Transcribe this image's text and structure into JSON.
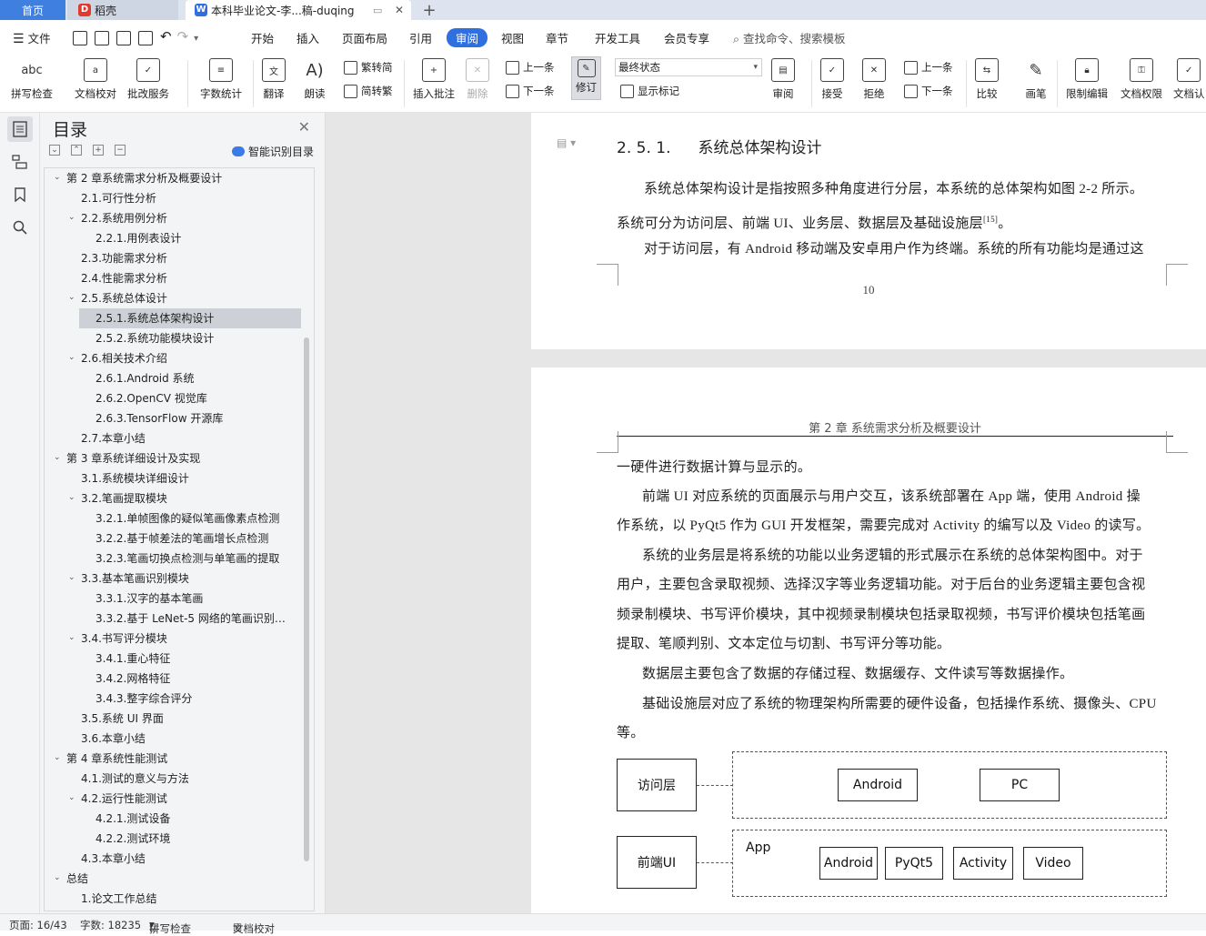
{
  "tabs": {
    "home": "首页",
    "docer": "稻壳",
    "doc": "本科毕业论文-李...稿-duqing",
    "add": "+"
  },
  "menu": {
    "file": "文件",
    "items": [
      "开始",
      "插入",
      "页面布局",
      "引用",
      "审阅",
      "视图",
      "章节",
      "开发工具",
      "会员专享"
    ],
    "search": "查找命令、搜索模板"
  },
  "ribbon": {
    "spell": "拼写检查",
    "proof": "文档校对",
    "correct": "批改服务",
    "wordcount": "字数统计",
    "translate": "翻译",
    "read": "朗读",
    "trad": "繁转简",
    "simp": "简转繁",
    "insert_comment": "插入批注",
    "delete": "删除",
    "prev": "上一条",
    "next": "下一条",
    "revise": "修订",
    "status": "最终状态",
    "show_marks": "显示标记",
    "review": "审阅",
    "accept": "接受",
    "reject": "拒绝",
    "prev2": "上一条",
    "next2": "下一条",
    "compare": "比较",
    "pen": "画笔",
    "restrict": "限制编辑",
    "perm": "文档权限",
    "cert": "文档认"
  },
  "toc": {
    "title": "目录",
    "smart": "智能识别目录",
    "items": [
      {
        "t": "第 2 章系统需求分析及概要设计",
        "l": 0,
        "e": "v"
      },
      {
        "t": "2.1.可行性分析",
        "l": 1,
        "e": ""
      },
      {
        "t": "2.2.系统用例分析",
        "l": 1,
        "e": "v"
      },
      {
        "t": "2.2.1.用例表设计",
        "l": 2,
        "e": ""
      },
      {
        "t": "2.3.功能需求分析",
        "l": 1,
        "e": ""
      },
      {
        "t": "2.4.性能需求分析",
        "l": 1,
        "e": ""
      },
      {
        "t": "2.5.系统总体设计",
        "l": 1,
        "e": "v"
      },
      {
        "t": "2.5.1.系统总体架构设计",
        "l": 2,
        "e": "",
        "sel": true
      },
      {
        "t": "2.5.2.系统功能模块设计",
        "l": 2,
        "e": ""
      },
      {
        "t": "2.6.相关技术介绍",
        "l": 1,
        "e": "v"
      },
      {
        "t": "2.6.1.Android 系统",
        "l": 2,
        "e": ""
      },
      {
        "t": "2.6.2.OpenCV 视觉库",
        "l": 2,
        "e": ""
      },
      {
        "t": "2.6.3.TensorFlow 开源库",
        "l": 2,
        "e": ""
      },
      {
        "t": "2.7.本章小结",
        "l": 1,
        "e": ""
      },
      {
        "t": "第 3 章系统详细设计及实现",
        "l": 0,
        "e": "v"
      },
      {
        "t": "3.1.系统模块详细设计",
        "l": 1,
        "e": ""
      },
      {
        "t": "3.2.笔画提取模块",
        "l": 1,
        "e": "v"
      },
      {
        "t": "3.2.1.单帧图像的疑似笔画像素点检测",
        "l": 2,
        "e": ""
      },
      {
        "t": "3.2.2.基于帧差法的笔画增长点检测",
        "l": 2,
        "e": ""
      },
      {
        "t": "3.2.3.笔画切换点检测与单笔画的提取",
        "l": 2,
        "e": ""
      },
      {
        "t": "3.3.基本笔画识别模块",
        "l": 1,
        "e": "v"
      },
      {
        "t": "3.3.1.汉字的基本笔画",
        "l": 2,
        "e": ""
      },
      {
        "t": "3.3.2.基于 LeNet-5 网络的笔画识别训...",
        "l": 2,
        "e": ""
      },
      {
        "t": "3.4.书写评分模块",
        "l": 1,
        "e": "v"
      },
      {
        "t": "3.4.1.重心特征",
        "l": 2,
        "e": ""
      },
      {
        "t": "3.4.2.网格特征",
        "l": 2,
        "e": ""
      },
      {
        "t": "3.4.3.整字综合评分",
        "l": 2,
        "e": ""
      },
      {
        "t": "3.5.系统 UI 界面",
        "l": 1,
        "e": ""
      },
      {
        "t": "3.6.本章小结",
        "l": 1,
        "e": ""
      },
      {
        "t": "第 4 章系统性能测试",
        "l": 0,
        "e": "v"
      },
      {
        "t": "4.1.测试的意义与方法",
        "l": 1,
        "e": ""
      },
      {
        "t": "4.2.运行性能测试",
        "l": 1,
        "e": "v"
      },
      {
        "t": "4.2.1.测试设备",
        "l": 2,
        "e": ""
      },
      {
        "t": "4.2.2.测试环境",
        "l": 2,
        "e": ""
      },
      {
        "t": "4.3.本章小结",
        "l": 1,
        "e": ""
      },
      {
        "t": "总结",
        "l": 0,
        "e": "v"
      },
      {
        "t": "1.论文工作总结",
        "l": 1,
        "e": ""
      }
    ]
  },
  "page1": {
    "heading_num": "2. 5. 1.",
    "heading": "系统总体架构设计",
    "p1": "系统总体架构设计是指按照多种角度进行分层，本系统的总体架构如图 2-2 所示。",
    "p2": "系统可分为访问层、前端 UI、业务层、数据层及基础设施层",
    "p2_ref": "[15]",
    "p2_end": "。",
    "p3": "对于访问层，有 Android 移动端及安卓用户作为终端。系统的所有功能均是通过这",
    "page_num": "10"
  },
  "page2": {
    "header": "第 2 章  系统需求分析及概要设计",
    "l1": "一硬件进行数据计算与显示的。",
    "l2": "前端 UI 对应系统的页面展示与用户交互，该系统部署在 App 端，使用 Android 操",
    "l3": "作系统，以 PyQt5 作为 GUI 开发框架，需要完成对 Activity 的编写以及 Video 的读写。",
    "l4": "系统的业务层是将系统的功能以业务逻辑的形式展示在系统的总体架构图中。对于",
    "l5": "用户，主要包含录取视频、选择汉字等业务逻辑功能。对于后台的业务逻辑主要包含视",
    "l6": "频录制模块、书写评价模块，其中视频录制模块包括录取视频，书写评价模块包括笔画",
    "l7": "提取、笔顺判别、文本定位与切割、书写评分等功能。",
    "l8": "数据层主要包含了数据的存储过程、数据缓存、文件读写等数据操作。",
    "l9": "基础设施层对应了系统的物理架构所需要的硬件设备，包括操作系统、摄像头、CPU",
    "l10": "等。",
    "diagram": {
      "access": "访问层",
      "android": "Android",
      "pc": "PC",
      "frontend": "前端UI",
      "app": "App",
      "android2": "Android",
      "pyqt5": "PyQt5",
      "activity": "Activity",
      "video": "Video"
    }
  },
  "status": {
    "page": "页面: 16/43",
    "words": "字数: 18235",
    "spell": "拼写检查",
    "proof": "文档校对"
  }
}
